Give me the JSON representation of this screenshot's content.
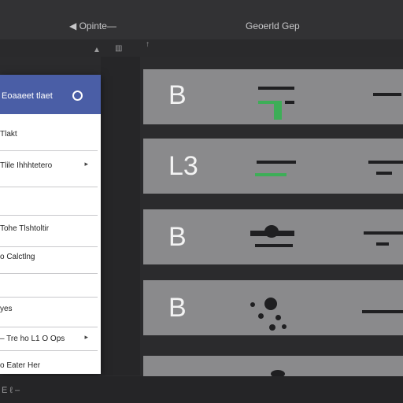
{
  "topbar": {
    "left_label": "◀ Opinte—",
    "center_label": "Geoerld Gep"
  },
  "toolbar": {
    "up_arrow": "▲",
    "col_icon": "▥",
    "pin": "↑"
  },
  "menu": {
    "header_label": "Eoaaeet tlaet",
    "items": [
      {
        "label": "Tlakt",
        "arrow": ""
      },
      {
        "label": "Tlile Ihhhtetero",
        "arrow": "▸"
      },
      {
        "label": "",
        "arrow": ""
      },
      {
        "label": "Tohe Tlshtoltir",
        "arrow": ""
      },
      {
        "label": "o Calctlng",
        "arrow": ""
      },
      {
        "label": "",
        "arrow": ""
      },
      {
        "label": "yes",
        "arrow": ""
      },
      {
        "label": "– Tre ho L1 O Ops",
        "arrow": "▸"
      },
      {
        "label": "o Eater Her",
        "arrow": ""
      }
    ]
  },
  "cards": [
    {
      "letter": "B"
    },
    {
      "letter": "L3"
    },
    {
      "letter": "B"
    },
    {
      "letter": "B"
    },
    {
      "letter": ""
    }
  ],
  "footer": {
    "label": "E ℓ –"
  },
  "colors": {
    "accent": "#4a5ea6",
    "green": "#3dae57",
    "card_bg": "#8a8a8c"
  }
}
